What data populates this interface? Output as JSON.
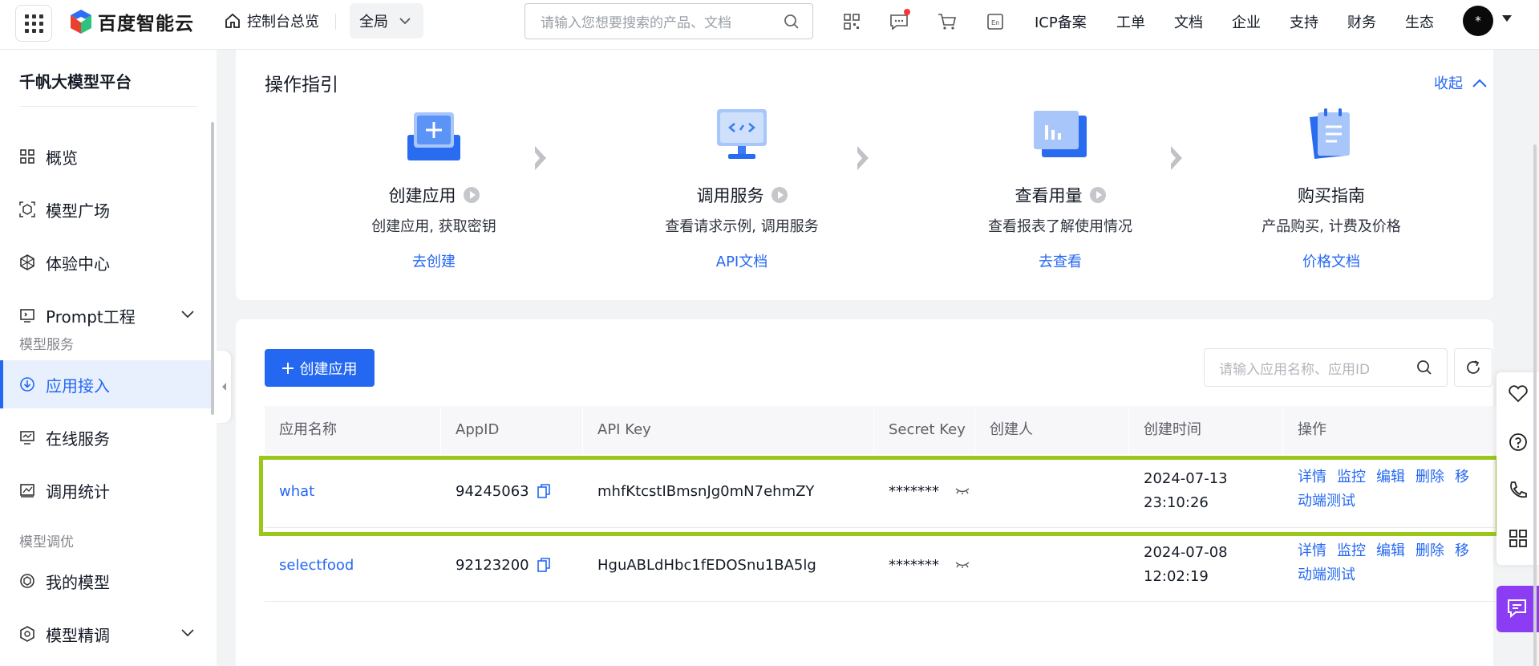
{
  "topbar": {
    "brand": "百度智能云",
    "home_label": "控制台总览",
    "scope_label": "全局",
    "search_placeholder": "请输入您想要搜索的产品、文档",
    "nav": [
      "ICP备案",
      "工单",
      "文档",
      "企业",
      "支持",
      "财务",
      "生态"
    ],
    "avatar_initial": "*"
  },
  "sidebar": {
    "title": "千帆大模型平台",
    "items_top": [
      "概览",
      "模型广场",
      "体验中心",
      "Prompt工程"
    ],
    "group1": "模型服务",
    "items_service": [
      "应用接入",
      "在线服务",
      "调用统计"
    ],
    "group2": "模型调优",
    "items_tune": [
      "我的模型",
      "模型精调"
    ]
  },
  "guide": {
    "title": "操作指引",
    "collapse_label": "收起",
    "steps": [
      {
        "name": "创建应用",
        "desc": "创建应用, 获取密钥",
        "link": "去创建"
      },
      {
        "name": "调用服务",
        "desc": "查看请求示例, 调用服务",
        "link": "API文档"
      },
      {
        "name": "查看用量",
        "desc": "查看报表了解使用情况",
        "link": "去查看"
      },
      {
        "name": "购买指南",
        "desc": "产品购买, 计费及价格",
        "link": "价格文档"
      }
    ]
  },
  "apps": {
    "create_label": "创建应用",
    "search_placeholder": "请输入应用名称、应用ID",
    "columns": [
      "应用名称",
      "AppID",
      "API Key",
      "Secret Key",
      "创建人",
      "创建时间",
      "操作"
    ],
    "rows": [
      {
        "name": "what",
        "appid": "94245063",
        "api_key": "mhfKtcstIBmsnJg0mN7ehmZY",
        "secret": "*******",
        "creator": "",
        "date": "2024-07-13",
        "time": "23:10:26"
      },
      {
        "name": "selectfood",
        "appid": "92123200",
        "api_key": "HguABLdHbc1fEDOSnu1BA5lg",
        "secret": "*******",
        "creator": "",
        "date": "2024-07-08",
        "time": "12:02:19"
      }
    ],
    "ops": [
      "详情",
      "监控",
      "编辑",
      "删除",
      "移动端测试"
    ]
  },
  "colors": {
    "accent": "#2468f2",
    "highlight": "#9bc71b",
    "chat": "#8c3df4"
  }
}
